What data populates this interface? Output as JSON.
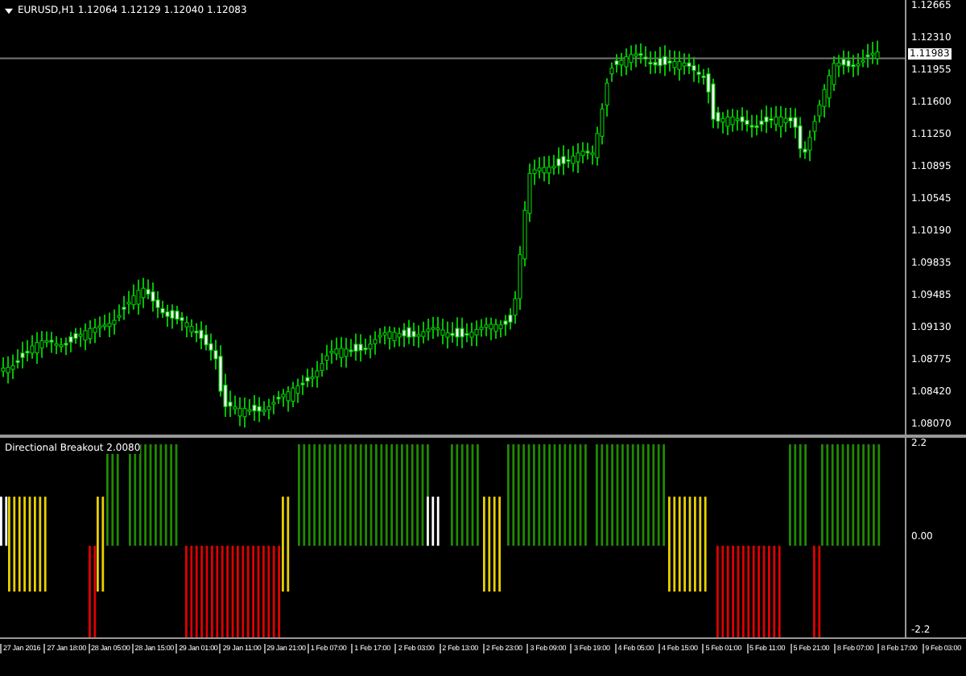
{
  "main_chart": {
    "title": "EURUSD,H1  1.12064 1.12129 1.12040 1.12083",
    "current_price": "1.11983",
    "price_scale": [
      "1.12665",
      "1.12310",
      "1.11955",
      "1.11600",
      "1.11250",
      "1.10895",
      "1.10545",
      "1.10190",
      "1.09835",
      "1.09485",
      "1.09130",
      "1.08775",
      "1.08420",
      "1.08070"
    ]
  },
  "indicator": {
    "title": "Directional Breakout 2.0080",
    "scale": [
      "2.2",
      "0.00",
      "-2.2"
    ]
  },
  "time_axis": [
    "27 Jan 2016",
    "27 Jan 18:00",
    "28 Jan 05:00",
    "28 Jan 15:00",
    "29 Jan 01:00",
    "29 Jan 11:00",
    "29 Jan 21:00",
    "1 Feb 07:00",
    "1 Feb 17:00",
    "2 Feb 03:00",
    "2 Feb 13:00",
    "2 Feb 23:00",
    "3 Feb 09:00",
    "3 Feb 19:00",
    "4 Feb 05:00",
    "4 Feb 15:00",
    "5 Feb 01:00",
    "5 Feb 11:00",
    "5 Feb 21:00",
    "8 Feb 07:00",
    "8 Feb 17:00",
    "9 Feb 03:00"
  ]
}
